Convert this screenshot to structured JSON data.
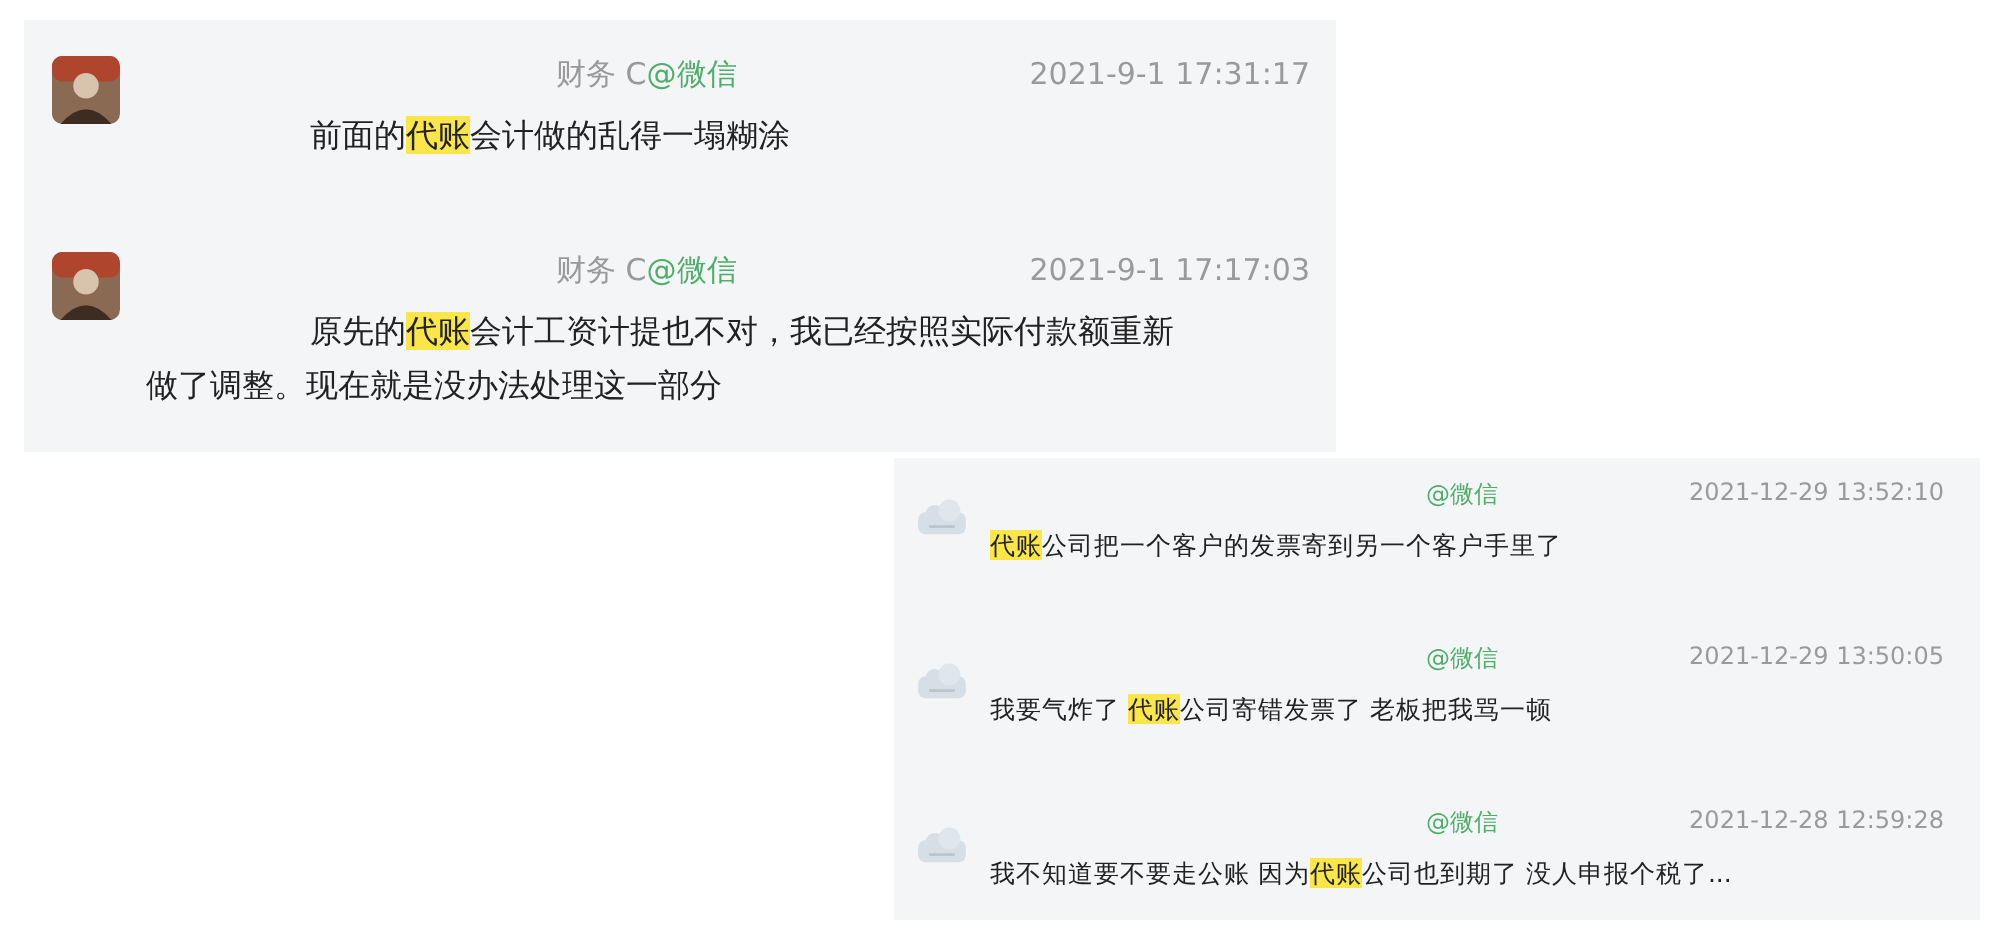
{
  "panels": [
    {
      "kind": "large",
      "messages": [
        {
          "sender": "财务 C",
          "source": "@微信",
          "time": "2021-9-1 17:31:17",
          "avatar": {
            "kind": "photo"
          },
          "segments": [
            {
              "text": "前面的",
              "highlighted": false
            },
            {
              "text": "代账",
              "highlighted": true
            },
            {
              "text": "会计做的乱得一塌糊涂",
              "highlighted": false
            }
          ]
        },
        {
          "sender": "财务 C",
          "source": "@微信",
          "time": "2021-9-1 17:17:03",
          "avatar": {
            "kind": "photo"
          },
          "segments": [
            {
              "text": "原先的",
              "highlighted": false
            },
            {
              "text": "代账",
              "highlighted": true
            },
            {
              "text": "会计工资计提也不对，我已经按照实际付款额重新做了调整。现在就是没办法处理这一部分",
              "highlighted": false
            }
          ]
        }
      ]
    },
    {
      "kind": "small",
      "messages": [
        {
          "source": "@微信",
          "time": "2021-12-29 13:52:10",
          "avatar": {
            "kind": "placeholder"
          },
          "segments": [
            {
              "text": "代账",
              "highlighted": true
            },
            {
              "text": "公司把一个客户的发票寄到另一个客户手里了",
              "highlighted": false
            }
          ]
        },
        {
          "source": "@微信",
          "time": "2021-12-29 13:50:05",
          "avatar": {
            "kind": "placeholder"
          },
          "segments": [
            {
              "text": "我要气炸了 ",
              "highlighted": false
            },
            {
              "text": "代账",
              "highlighted": true
            },
            {
              "text": "公司寄错发票了 老板把我骂一顿",
              "highlighted": false
            }
          ]
        },
        {
          "source": "@微信",
          "time": "2021-12-28 12:59:28",
          "avatar": {
            "kind": "placeholder"
          },
          "segments": [
            {
              "text": "我不知道要不要走公账 因为",
              "highlighted": false
            },
            {
              "text": "代账",
              "highlighted": true
            },
            {
              "text": "公司也到期了 没人申报个税了...",
              "highlighted": false
            }
          ]
        }
      ]
    }
  ]
}
